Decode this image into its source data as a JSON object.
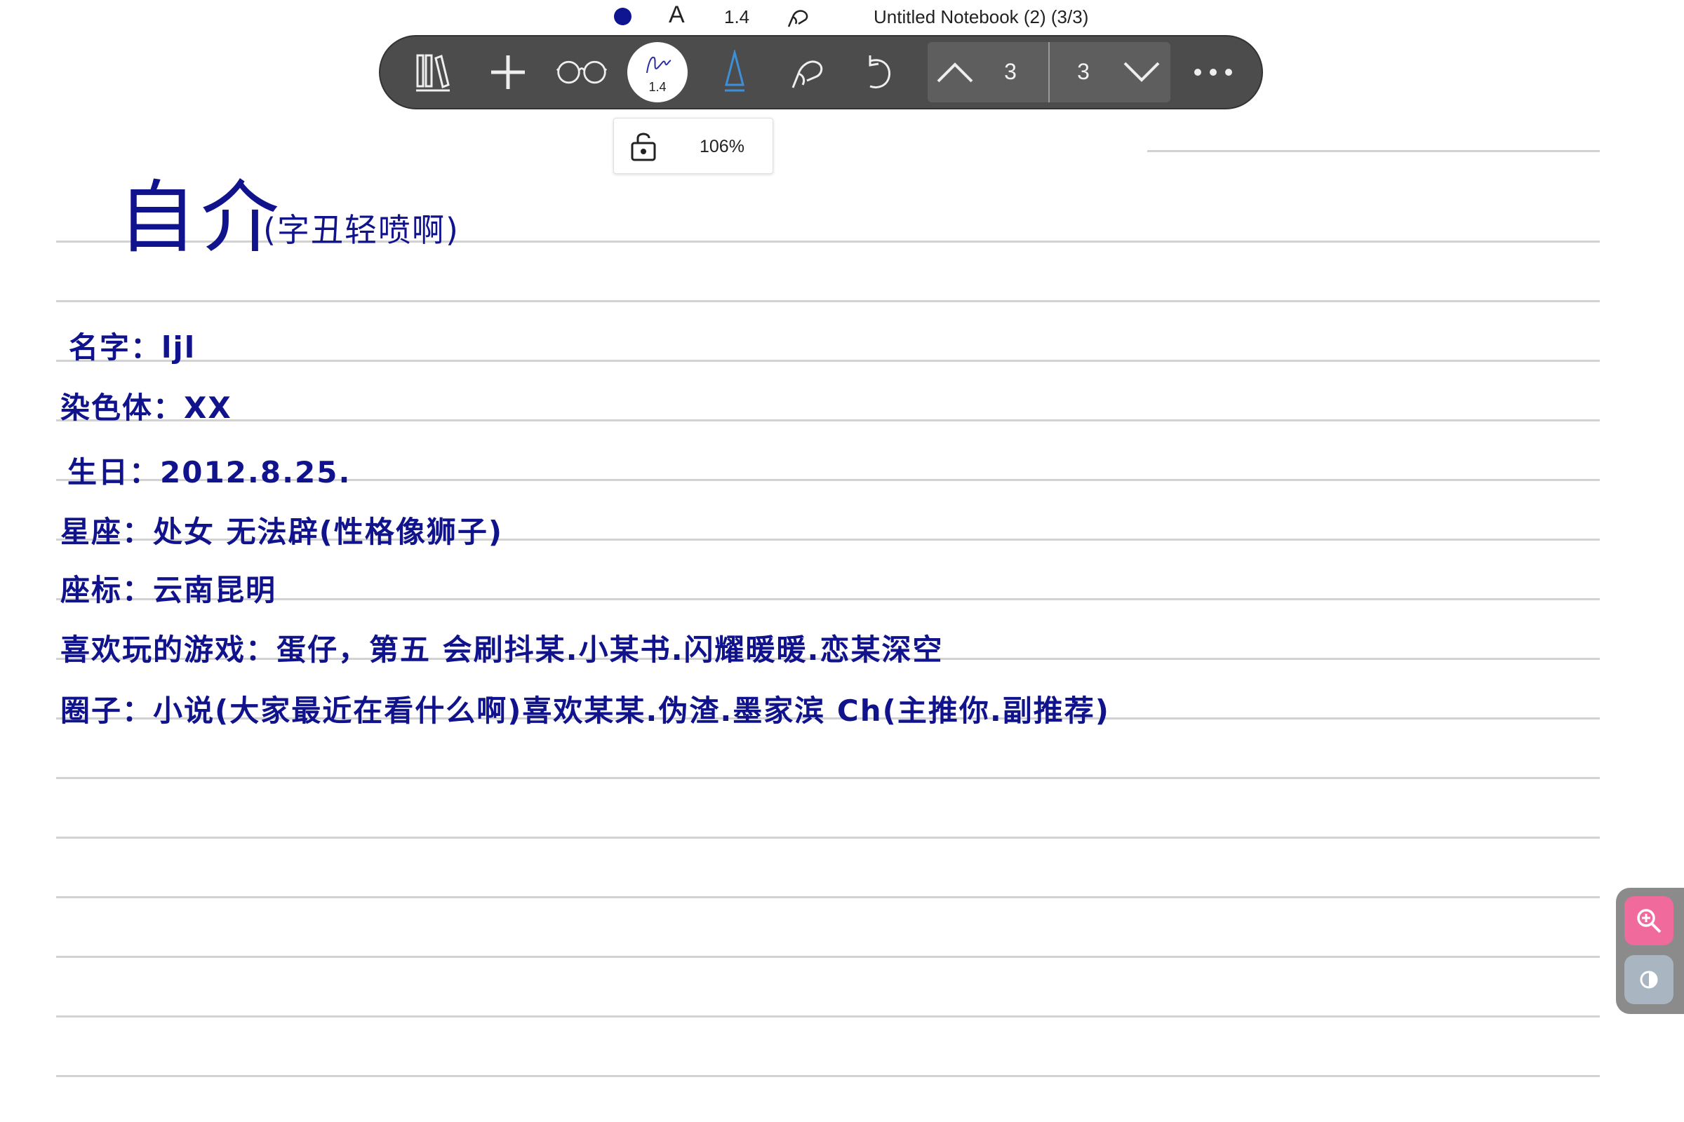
{
  "status": {
    "pen_width": "1.4",
    "pen_glyph": "A",
    "notebook_title": "Untitled Notebook (2) (3/3)",
    "pen_color": "#0f1491"
  },
  "toolbar": {
    "items": [
      "library-icon",
      "add-icon",
      "read-mode-icon",
      "pen-icon",
      "highlighter-icon",
      "lasso-icon",
      "undo-icon",
      "more-icon"
    ],
    "pen_width_label": "1.4",
    "current_page": "3",
    "total_pages": "3",
    "background": "#4c4c4c"
  },
  "zoom_popup": {
    "zoom_level": "106%"
  },
  "notebook": {
    "title": "自介",
    "subtitle": "(字丑轻喷啊)",
    "rows": [
      "名字：ljl",
      "染色体：XX",
      "生日：2012.8.25.",
      "星座：处女 无法辟(性格像狮子)",
      "座标：云南昆明",
      "喜欢玩的游戏：蛋仔，第五  会刷抖某.小某书.闪耀暖暖.恋某深空",
      "圈子：小说(大家最近在看什么啊)喜欢某某.伪渣.墨家滨   Ch(主推你.副推荐)"
    ],
    "ink_color": "#10138c"
  },
  "side_panel": {
    "buttons": [
      "zoom-in-icon",
      "contrast-icon"
    ],
    "zoom_color": "#f06a9c"
  }
}
